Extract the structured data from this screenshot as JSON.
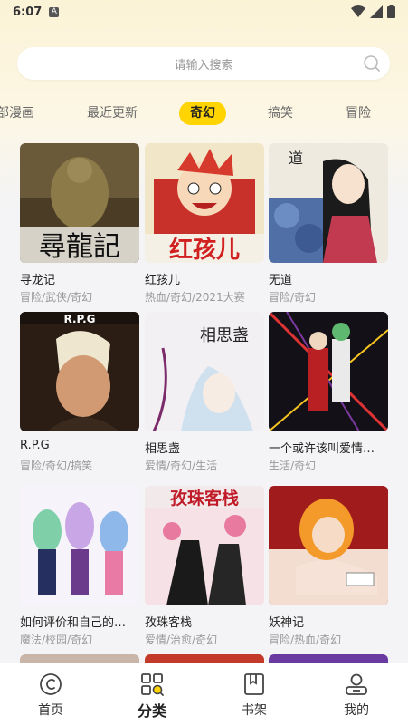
{
  "status_bar": {
    "time": "6:07",
    "notification": "A"
  },
  "search": {
    "placeholder": "请输入搜索"
  },
  "tabs": [
    {
      "label": "部漫画",
      "active": false
    },
    {
      "label": "最近更新",
      "active": false
    },
    {
      "label": "奇幻",
      "active": true
    },
    {
      "label": "搞笑",
      "active": false
    },
    {
      "label": "冒险",
      "active": false
    }
  ],
  "comics": [
    {
      "title": "寻龙记",
      "tags": "冒险/武侠/奇幻"
    },
    {
      "title": "红孩儿",
      "tags": "热血/奇幻/2021大赛"
    },
    {
      "title": "无道",
      "tags": "冒险/奇幻"
    },
    {
      "title": "R.P.G",
      "tags": "冒险/奇幻/搞笑"
    },
    {
      "title": "相思盏",
      "tags": "爱情/奇幻/生活"
    },
    {
      "title": "一个或许该叫爱情…",
      "tags": "生活/奇幻"
    },
    {
      "title": "如何评价和自己的…",
      "tags": "魔法/校园/奇幻"
    },
    {
      "title": "孜珠客栈",
      "tags": "爱情/治愈/奇幻"
    },
    {
      "title": "妖神记",
      "tags": "冒险/热血/奇幻"
    }
  ],
  "cover_text": {
    "c1": "尋龍記",
    "c2": "红孩儿",
    "c3": "道",
    "c4": "R.P.G",
    "c5": "相思盏",
    "c8": "孜珠客栈"
  },
  "bottom_nav": [
    {
      "label": "首页",
      "icon": "home-icon",
      "active": false
    },
    {
      "label": "分类",
      "icon": "category-icon",
      "active": true
    },
    {
      "label": "书架",
      "icon": "bookshelf-icon",
      "active": false
    },
    {
      "label": "我的",
      "icon": "profile-icon",
      "active": false
    }
  ],
  "colors": {
    "accent": "#ffd400",
    "background": "#f4f4f6"
  }
}
